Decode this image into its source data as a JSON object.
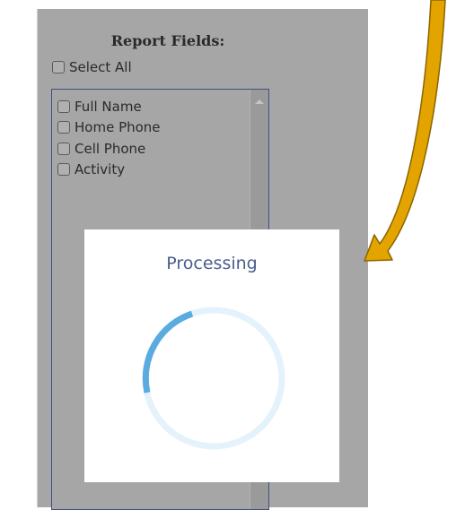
{
  "report_fields": {
    "title": "Report Fields:",
    "select_all_label": "Select All",
    "items": [
      {
        "label": "Full Name"
      },
      {
        "label": "Home Phone"
      },
      {
        "label": "Cell Phone"
      },
      {
        "label": "Activity"
      }
    ]
  },
  "processing_dialog": {
    "title": "Processing",
    "spinner_color": "#5aabdf",
    "spinner_track_color": "#e4f2fb"
  },
  "annotation": {
    "arrow_color": "#e3a400"
  }
}
